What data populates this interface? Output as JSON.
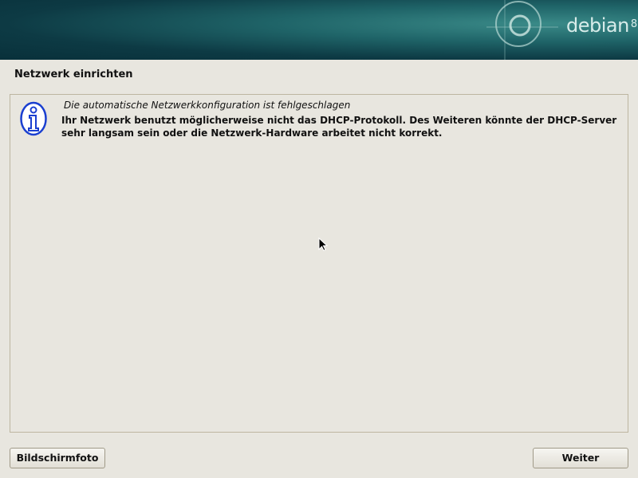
{
  "banner": {
    "logo_text": "debian",
    "version": "8"
  },
  "page": {
    "title": "Netzwerk einrichten"
  },
  "message": {
    "icon": "info-icon",
    "heading": "Die automatische Netzwerkkonfiguration ist fehlgeschlagen",
    "body": "Ihr Netzwerk benutzt möglicherweise nicht das DHCP-Protokoll. Des Weiteren könnte der DHCP-Server sehr langsam sein oder die Netzwerk-Hardware arbeitet nicht korrekt."
  },
  "buttons": {
    "screenshot": "Bildschirmfoto",
    "continue": "Weiter"
  },
  "colors": {
    "banner": "#0d3a44",
    "accent": "#1a3fd0"
  }
}
